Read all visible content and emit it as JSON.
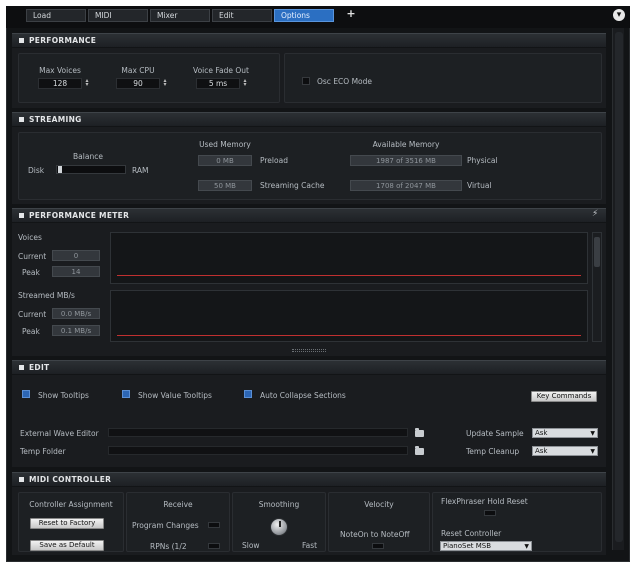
{
  "tabs": [
    {
      "label": "Load"
    },
    {
      "label": "MIDI"
    },
    {
      "label": "Mixer"
    },
    {
      "label": "Edit"
    },
    {
      "label": "Options",
      "active": true
    }
  ],
  "add_tab_label": "+",
  "sections": {
    "performance": {
      "title": "PERFORMANCE",
      "max_voices": {
        "label": "Max Voices",
        "value": "128"
      },
      "max_cpu": {
        "label": "Max CPU",
        "value": "90"
      },
      "voice_fade_out": {
        "label": "Voice Fade Out",
        "value": "5 ms"
      },
      "osc_eco_mode": {
        "label": "Osc ECO Mode",
        "checked": false
      }
    },
    "streaming": {
      "title": "STREAMING",
      "balance": {
        "label": "Balance",
        "left": "Disk",
        "right": "RAM"
      },
      "used_memory_header": "Used Memory",
      "available_memory_header": "Available Memory",
      "preload": {
        "value": "0 MB",
        "label": "Preload"
      },
      "streaming_cache": {
        "value": "50 MB",
        "label": "Streaming Cache"
      },
      "physical": {
        "value": "1987 of 3516 MB",
        "label": "Physical"
      },
      "virtual": {
        "value": "1708 of 2047 MB",
        "label": "Virtual"
      }
    },
    "performance_meter": {
      "title": "PERFORMANCE METER",
      "voices": {
        "label": "Voices",
        "current_label": "Current",
        "current_value": "0",
        "peak_label": "Peak",
        "peak_value": "14"
      },
      "streamed": {
        "label": "Streamed MB/s",
        "current_label": "Current",
        "current_value": "0.0 MB/s",
        "peak_label": "Peak",
        "peak_value": "0.1 MB/s"
      }
    },
    "edit": {
      "title": "EDIT",
      "show_tooltips": {
        "label": "Show Tooltips",
        "checked": true
      },
      "show_value_tooltips": {
        "label": "Show Value Tooltips",
        "checked": true
      },
      "auto_collapse": {
        "label": "Auto Collapse Sections",
        "checked": true
      },
      "key_commands": "Key Commands",
      "external_wave_editor": "External Wave Editor",
      "temp_folder": "Temp Folder",
      "update_sample": {
        "label": "Update Sample",
        "value": "Ask"
      },
      "temp_cleanup": {
        "label": "Temp Cleanup",
        "value": "Ask"
      }
    },
    "midi_controller": {
      "title": "MIDI CONTROLLER",
      "controller_assignment": {
        "label": "Controller Assignment",
        "reset": "Reset to Factory",
        "save": "Save as Default"
      },
      "receive": {
        "label": "Receive",
        "program_changes": "Program Changes",
        "rpn": "RPNs (1/2"
      },
      "smoothing": {
        "label": "Smoothing",
        "left": "Slow",
        "right": "Fast"
      },
      "velocity": {
        "label": "Velocity",
        "note_on_off": "NoteOn to NoteOff"
      },
      "flex_hold": {
        "label": "FlexPhraser Hold Reset"
      },
      "reset_controller": {
        "label": "Reset Controller",
        "value": "PianoSet MSB"
      }
    }
  }
}
